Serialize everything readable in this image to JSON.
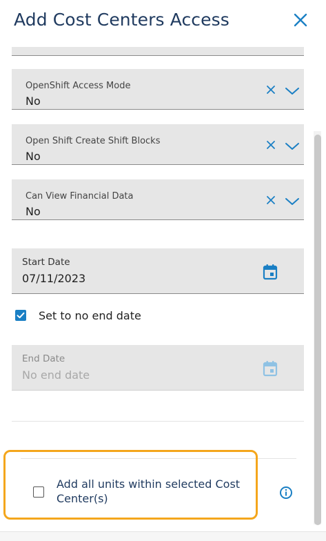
{
  "header": {
    "title": "Add Cost Centers Access"
  },
  "fields": {
    "openshift_access_mode": {
      "label": "OpenShift Access Mode",
      "value": "No"
    },
    "open_shift_create_shift_blocks": {
      "label": "Open Shift Create Shift Blocks",
      "value": "No"
    },
    "can_view_financial_data": {
      "label": "Can View Financial Data",
      "value": "No"
    },
    "start_date": {
      "label": "Start Date",
      "value": "07/11/2023"
    },
    "no_end_date_checkbox": {
      "label": "Set to no end date",
      "checked": true
    },
    "end_date": {
      "label": "End Date",
      "placeholder": "No end date",
      "disabled": true
    },
    "add_all_units_checkbox": {
      "label": "Add all units within selected Cost Center(s)",
      "checked": false
    }
  },
  "icons": {
    "close": "close-icon",
    "clear": "clear-icon",
    "dropdown": "chevron-down-icon",
    "calendar": "calendar-icon",
    "info": "info-icon"
  },
  "colors": {
    "accent": "#1a7fc4",
    "title": "#1f3a5f",
    "highlight_border": "#f4a61c",
    "field_bg": "#e6e6e6"
  }
}
